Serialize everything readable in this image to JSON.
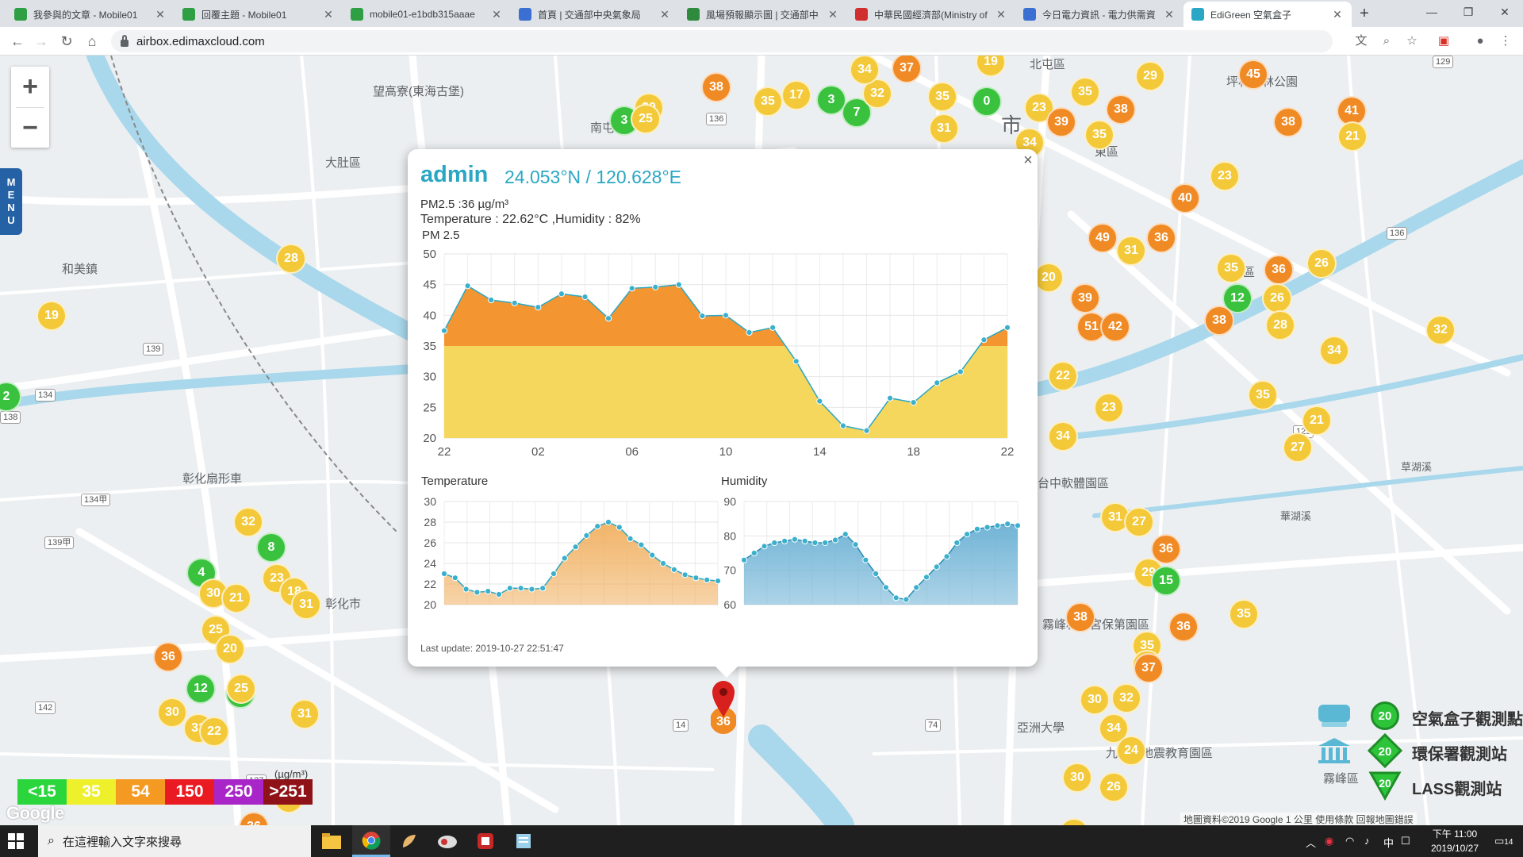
{
  "browser": {
    "tabs": [
      {
        "label": "我參與的文章 - Mobile01",
        "color": "#2ea043",
        "active": false
      },
      {
        "label": "回覆主題 - Mobile01",
        "color": "#2ea043",
        "active": false
      },
      {
        "label": "mobile01-e1bdb315aaae",
        "color": "#2ea043",
        "active": false
      },
      {
        "label": "首頁 | 交通部中央氣象局",
        "color": "#3b6fd1",
        "active": false
      },
      {
        "label": "風場預報顯示圖 | 交通部中",
        "color": "#2e8b3e",
        "active": false
      },
      {
        "label": "中華民國經濟部(Ministry of",
        "color": "#d12f2f",
        "active": false
      },
      {
        "label": "今日電力資訊 - 電力供需資",
        "color": "#3b6fd1",
        "active": false
      },
      {
        "label": "EdiGreen 空氣盒子",
        "color": "#2aa7c4",
        "active": true
      }
    ],
    "new_tab": "+",
    "url": "airbox.edimaxcloud.com"
  },
  "map": {
    "labels": [
      {
        "text": "望高寮(東海古堡)"
      },
      {
        "text": "大肚區"
      },
      {
        "text": "和美鎮"
      },
      {
        "text": "彰化市"
      },
      {
        "text": "彰化扇形車"
      },
      {
        "text": "北屯區"
      },
      {
        "text": "坪林森林公園"
      },
      {
        "text": "霧峰林家宮保第園區"
      },
      {
        "text": "亞洲大學"
      },
      {
        "text": "九二一地震教育園區"
      },
      {
        "text": "霧峰區"
      },
      {
        "text": "草湖溪"
      },
      {
        "text": "華湖溪"
      },
      {
        "text": "台中軟體園區"
      },
      {
        "text": "平區"
      },
      {
        "text": "市"
      },
      {
        "text": "南屯"
      },
      {
        "text": "東區"
      }
    ],
    "road_signs": [
      "136",
      "139",
      "134",
      "138",
      "134甲",
      "139甲",
      "142",
      "137",
      "129",
      "14",
      "74",
      "136",
      "129"
    ],
    "zoom_in": "+",
    "zoom_out": "−",
    "menu": "MENU",
    "markers": [
      {
        "v": "3",
        "c": "#3ac23f"
      },
      {
        "v": "30",
        "c": "#f3c93a"
      },
      {
        "v": "38",
        "c": "#f08a24"
      },
      {
        "v": "35",
        "c": "#f3c93a"
      },
      {
        "v": "17",
        "c": "#f3c93a"
      },
      {
        "v": "3",
        "c": "#3ac23f"
      },
      {
        "v": "7",
        "c": "#3ac23f"
      },
      {
        "v": "32",
        "c": "#f3c93a"
      },
      {
        "v": "34",
        "c": "#f3c93a"
      },
      {
        "v": "37",
        "c": "#f08a24"
      },
      {
        "v": "19",
        "c": "#f3c93a"
      },
      {
        "v": "35",
        "c": "#f3c93a"
      },
      {
        "v": "0",
        "c": "#3ac23f"
      },
      {
        "v": "23",
        "c": "#f3c93a"
      },
      {
        "v": "35",
        "c": "#f3c93a"
      },
      {
        "v": "38",
        "c": "#f08a24"
      },
      {
        "v": "29",
        "c": "#f3c93a"
      },
      {
        "v": "45",
        "c": "#f08a24"
      },
      {
        "v": "38",
        "c": "#f08a24"
      },
      {
        "v": "41",
        "c": "#f08a24"
      },
      {
        "v": "21",
        "c": "#f3c93a"
      },
      {
        "v": "39",
        "c": "#f08a24"
      },
      {
        "v": "35",
        "c": "#f3c93a"
      },
      {
        "v": "34",
        "c": "#f3c93a"
      },
      {
        "v": "31",
        "c": "#f3c93a"
      },
      {
        "v": "35",
        "c": "#f3c93a"
      },
      {
        "v": "34",
        "c": "#f3c93a"
      },
      {
        "v": "40",
        "c": "#f08a24"
      },
      {
        "v": "23",
        "c": "#f3c93a"
      },
      {
        "v": "49",
        "c": "#f08a24"
      },
      {
        "v": "36",
        "c": "#f08a24"
      },
      {
        "v": "31",
        "c": "#f3c93a"
      },
      {
        "v": "35",
        "c": "#f3c93a"
      },
      {
        "v": "36",
        "c": "#f08a24"
      },
      {
        "v": "26",
        "c": "#f3c93a"
      },
      {
        "v": "20",
        "c": "#f3c93a"
      },
      {
        "v": "39",
        "c": "#f08a24"
      },
      {
        "v": "12",
        "c": "#3ac23f"
      },
      {
        "v": "26",
        "c": "#f3c93a"
      },
      {
        "v": "51",
        "c": "#f08a24"
      },
      {
        "v": "42",
        "c": "#f08a24"
      },
      {
        "v": "38",
        "c": "#f08a24"
      },
      {
        "v": "28",
        "c": "#f3c93a"
      },
      {
        "v": "32",
        "c": "#f3c93a"
      },
      {
        "v": "34",
        "c": "#f3c93a"
      },
      {
        "v": "22",
        "c": "#f3c93a"
      },
      {
        "v": "23",
        "c": "#f3c93a"
      },
      {
        "v": "35",
        "c": "#f3c93a"
      },
      {
        "v": "34",
        "c": "#f3c93a"
      },
      {
        "v": "21",
        "c": "#f3c93a"
      },
      {
        "v": "27",
        "c": "#f3c93a"
      },
      {
        "v": "31",
        "c": "#f3c93a"
      },
      {
        "v": "27",
        "c": "#f3c93a"
      },
      {
        "v": "36",
        "c": "#f08a24"
      },
      {
        "v": "29",
        "c": "#f3c93a"
      },
      {
        "v": "15",
        "c": "#3ac23f"
      },
      {
        "v": "38",
        "c": "#f08a24"
      },
      {
        "v": "35",
        "c": "#f3c93a"
      },
      {
        "v": "36",
        "c": "#f08a24"
      },
      {
        "v": "35",
        "c": "#f3c93a"
      },
      {
        "v": "33",
        "c": "#f3c93a"
      },
      {
        "v": "37",
        "c": "#f08a24"
      },
      {
        "v": "32",
        "c": "#f3c93a"
      },
      {
        "v": "34",
        "c": "#f3c93a"
      },
      {
        "v": "24",
        "c": "#f3c93a"
      },
      {
        "v": "23",
        "c": "#f3c93a"
      },
      {
        "v": "28",
        "c": "#f3c93a"
      },
      {
        "v": "19",
        "c": "#f3c93a"
      },
      {
        "v": "2",
        "c": "#3ac23f"
      },
      {
        "v": "32",
        "c": "#f3c93a"
      },
      {
        "v": "8",
        "c": "#3ac23f"
      },
      {
        "v": "4",
        "c": "#3ac23f"
      },
      {
        "v": "23",
        "c": "#f3c93a"
      },
      {
        "v": "18",
        "c": "#f3c93a"
      },
      {
        "v": "30",
        "c": "#f3c93a"
      },
      {
        "v": "21",
        "c": "#f3c93a"
      },
      {
        "v": "31",
        "c": "#f3c93a"
      },
      {
        "v": "25",
        "c": "#f3c93a"
      },
      {
        "v": "20",
        "c": "#f3c93a"
      },
      {
        "v": "36",
        "c": "#f08a24"
      },
      {
        "v": "12",
        "c": "#3ac23f"
      },
      {
        "v": "5",
        "c": "#3ac23f"
      },
      {
        "v": "25",
        "c": "#f3c93a"
      },
      {
        "v": "30",
        "c": "#f3c93a"
      },
      {
        "v": "31",
        "c": "#f3c93a"
      },
      {
        "v": "22",
        "c": "#f3c93a"
      },
      {
        "v": "30",
        "c": "#f3c93a"
      },
      {
        "v": "25",
        "c": "#f3c93a"
      },
      {
        "v": "31",
        "c": "#f3c93a"
      },
      {
        "v": "33",
        "c": "#f3c93a"
      },
      {
        "v": "36",
        "c": "#f08a24"
      },
      {
        "v": "26",
        "c": "#f3c93a"
      },
      {
        "v": "30",
        "c": "#f3c93a"
      }
    ]
  },
  "popup": {
    "close": "×",
    "station": "admin",
    "coords": "24.053°N / 120.628°E",
    "pm25": "PM2.5 :36 µg/m³",
    "temp_hum": "Temperature : 22.62°C ,Humidity : 82%",
    "chart_title": "PM 2.5",
    "temperature_title": "Temperature",
    "humidity_title": "Humidity",
    "last_update": "Last update: 2019-10-27 22:51:47",
    "pin_value": "36"
  },
  "chart_data": [
    {
      "type": "area",
      "title": "PM 2.5",
      "x_ticks": [
        "22",
        "02",
        "06",
        "10",
        "14",
        "18",
        "22"
      ],
      "ylim": [
        20,
        50
      ],
      "y_ticks": [
        20,
        25,
        30,
        35,
        40,
        45,
        50
      ],
      "threshold": 35,
      "colors": {
        "above": "#f39631",
        "below": "#f6d75e"
      },
      "values": [
        37.5,
        44.8,
        42.5,
        42,
        41.3,
        43.5,
        43,
        39.5,
        44.4,
        44.6,
        45,
        39.9,
        40,
        37.2,
        38,
        32.5,
        26,
        22,
        21.2,
        26.5,
        25.8,
        29,
        30.8,
        36,
        38
      ]
    },
    {
      "type": "area",
      "title": "Temperature",
      "ylim": [
        20,
        30
      ],
      "y_ticks": [
        20,
        22,
        24,
        26,
        28,
        30
      ],
      "color": "#f0b060",
      "values": [
        23,
        22.6,
        21.5,
        21.2,
        21.3,
        21,
        21.6,
        21.6,
        21.5,
        21.6,
        23,
        24.5,
        25.6,
        26.7,
        27.6,
        28,
        27.5,
        26.4,
        25.8,
        24.8,
        24,
        23.4,
        22.9,
        22.6,
        22.4,
        22.3
      ]
    },
    {
      "type": "area",
      "title": "Humidity",
      "ylim": [
        60,
        90
      ],
      "y_ticks": [
        60,
        70,
        80,
        90
      ],
      "color": "#6ab0d4",
      "values": [
        73,
        75,
        77,
        78,
        78.5,
        79,
        78.5,
        78,
        78,
        78.8,
        80.5,
        77.5,
        73,
        69,
        65,
        62,
        61.5,
        65,
        68,
        71,
        74,
        78,
        80.5,
        82,
        82.5,
        83,
        83.5,
        83
      ]
    }
  ],
  "legend": {
    "scale": [
      {
        "label": "<15",
        "color": "#2bd63d"
      },
      {
        "label": "35",
        "color": "#eef02c"
      },
      {
        "label": "54",
        "color": "#f49a22"
      },
      {
        "label": "150",
        "color": "#ea1a22"
      },
      {
        "label": "250",
        "color": "#a826c7"
      },
      {
        "label": ">251",
        "color": "#8e1218"
      }
    ],
    "unit": "(µg/m³)",
    "stations": [
      {
        "sample": "20",
        "label": "空氣盒子觀測點"
      },
      {
        "sample": "20",
        "label": "環保署觀測站"
      },
      {
        "sample": "20",
        "label": "LASS觀測站"
      }
    ],
    "attribution": "地圖資料©2019 Google   1 公里   使用條款   回報地圖錯誤",
    "google": "Google"
  },
  "taskbar": {
    "search_placeholder": "在這裡輸入文字來搜尋",
    "time": "下午 11:00",
    "date": "2019/10/27",
    "ime": "中",
    "notify_count": "14"
  }
}
